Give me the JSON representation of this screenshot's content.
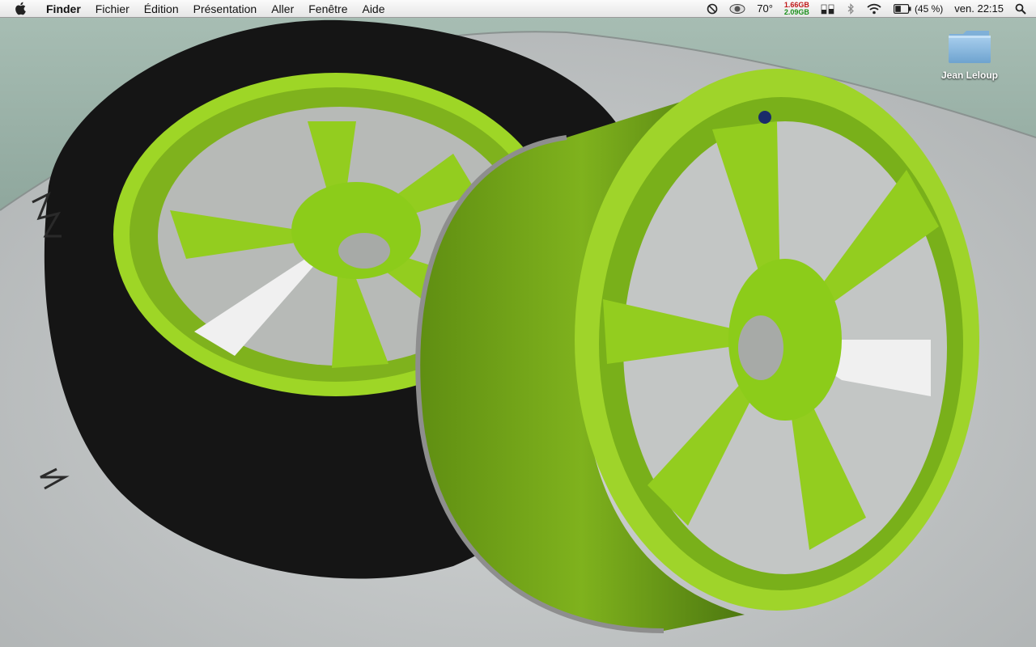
{
  "menubar": {
    "apple_icon": "apple-icon",
    "app_name": "Finder",
    "menus": [
      "Fichier",
      "Édition",
      "Présentation",
      "Aller",
      "Fenêtre",
      "Aide"
    ],
    "status": {
      "temperature": "70°",
      "memory_used": "1.66GB",
      "memory_free": "2.09GB",
      "battery": "(45 %)",
      "battery_level": 0.45,
      "clock": "ven. 22:15"
    }
  },
  "desktop": {
    "icons": [
      {
        "label": "Jean Leloup",
        "icon": "folder-icon"
      }
    ]
  },
  "colors": {
    "wheel_green": "#8ccc1a",
    "tire_black": "#141414",
    "wall": "#9fb6ac",
    "floor": "#c4c7c8"
  }
}
